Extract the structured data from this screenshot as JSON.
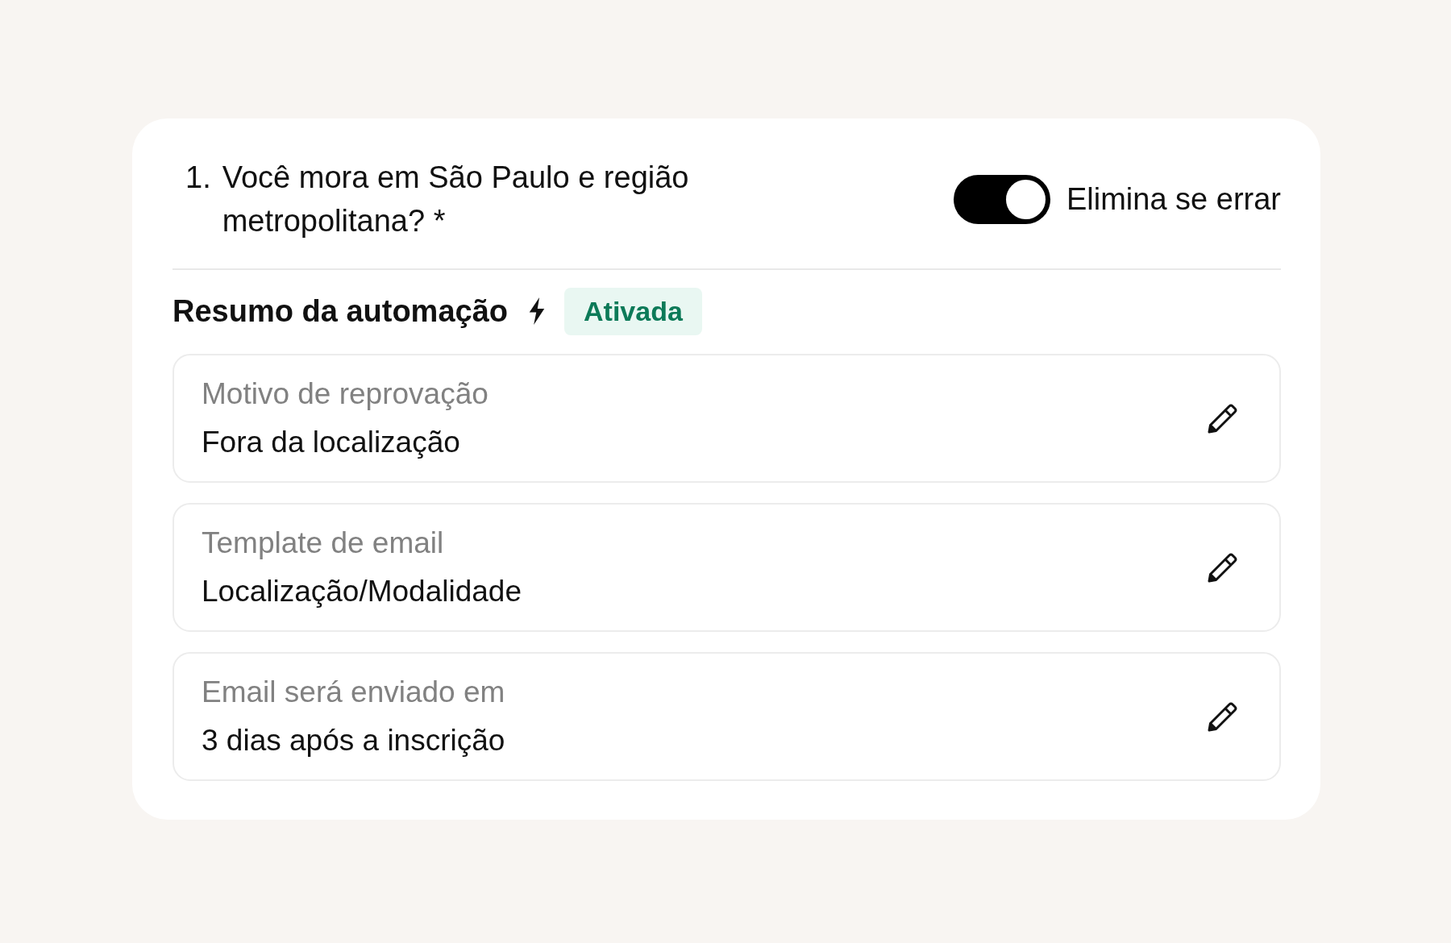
{
  "question": {
    "number": "1.",
    "text": "Você mora em São Paulo e região metropolitana? *"
  },
  "toggle": {
    "label": "Elimina se errar",
    "on": true
  },
  "summary": {
    "title": "Resumo da automação",
    "badge": "Ativada"
  },
  "items": [
    {
      "label": "Motivo de reprovação",
      "value": "Fora da localização"
    },
    {
      "label": "Template de email",
      "value": "Localização/Modalidade"
    },
    {
      "label": "Email será enviado em",
      "value": "3 dias após a inscrição"
    }
  ]
}
